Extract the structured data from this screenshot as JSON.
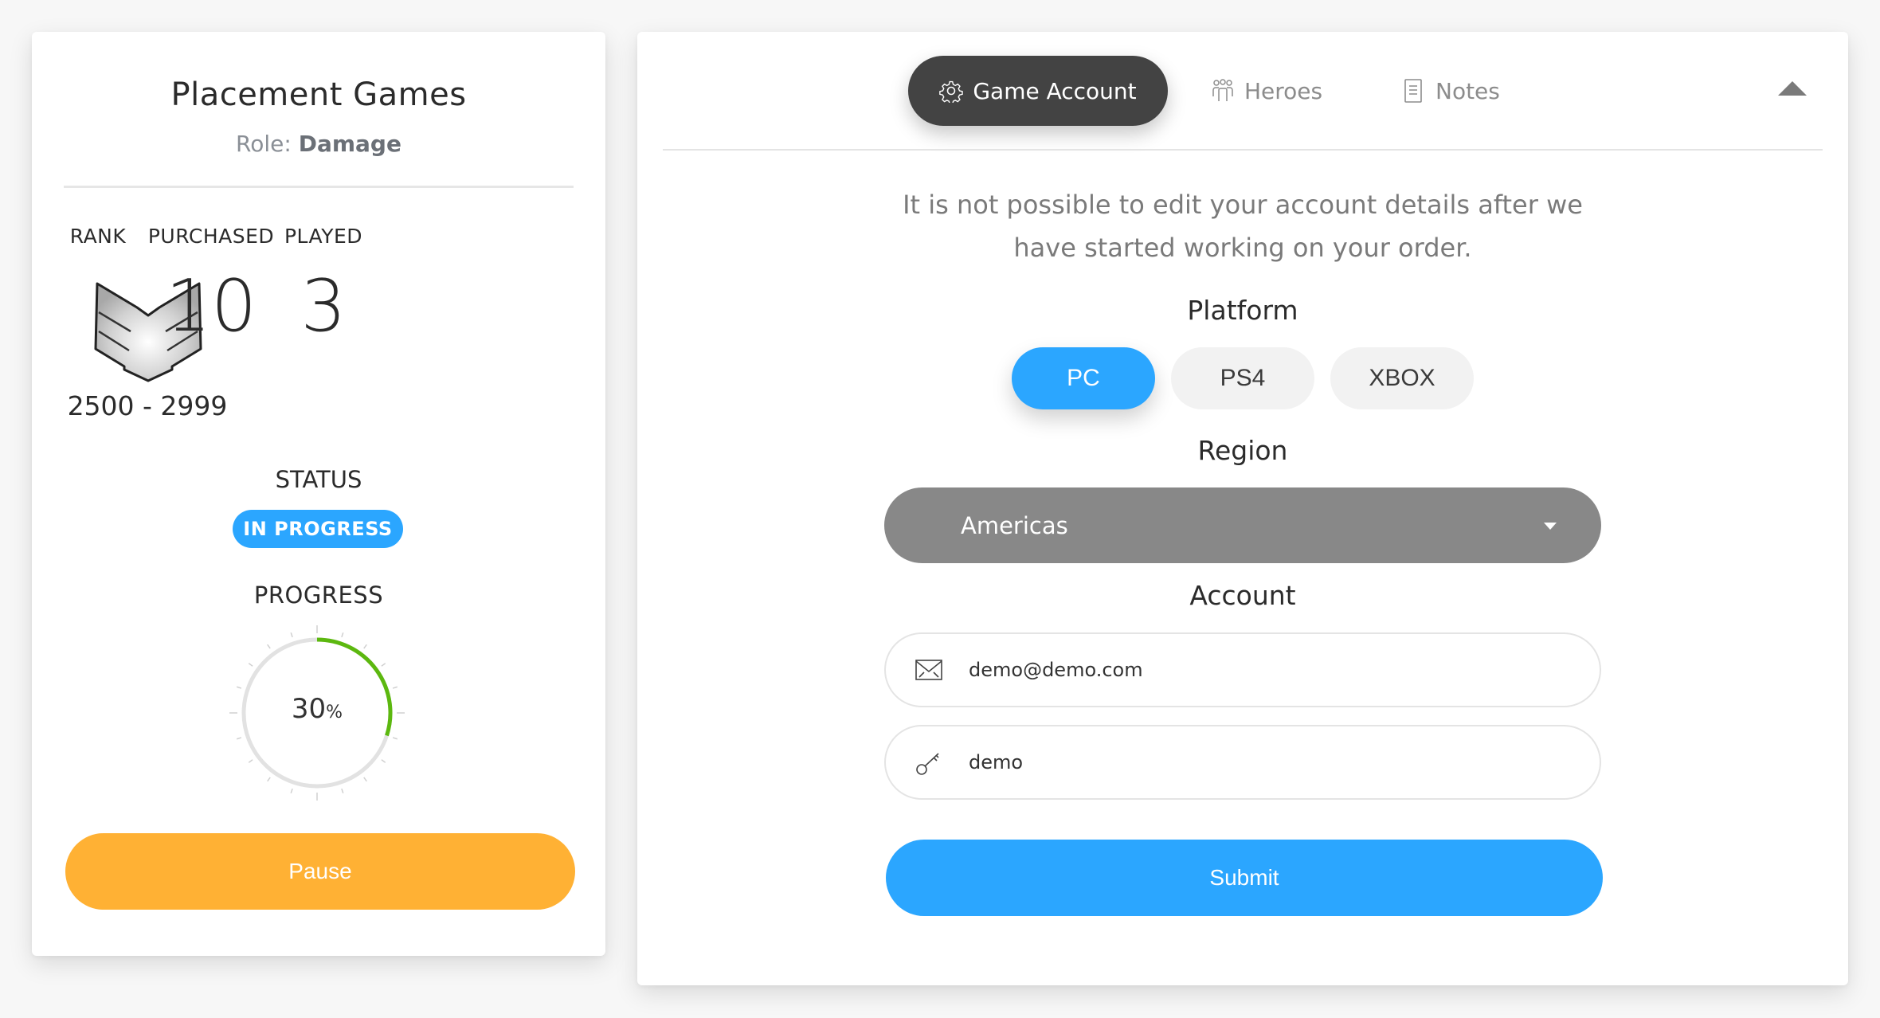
{
  "summary": {
    "title": "Placement Games",
    "role_label": "Role:",
    "role_value": "Damage",
    "stats": {
      "rank_label": "RANK",
      "purchased_label": "PURCHASED",
      "played_label": "PLAYED",
      "purchased_value": "10",
      "played_value": "3",
      "rank_icon": "chevron-rank-icon",
      "rank_range": "2500 - 2999"
    },
    "status_label": "STATUS",
    "status_value": "IN PROGRESS",
    "progress_label": "PROGRESS",
    "progress_value": 30,
    "progress_number": "30",
    "progress_unit": "%",
    "pause_label": "Pause"
  },
  "tabs": [
    {
      "label": "Game Account",
      "icon": "gear-icon",
      "active": true
    },
    {
      "label": "Heroes",
      "icon": "group-icon",
      "active": false
    },
    {
      "label": "Notes",
      "icon": "document-icon",
      "active": false
    }
  ],
  "collapse_icon": "triangle-up-icon",
  "account_form": {
    "notice": "It is not possible to edit your account details after we have started working on your order.",
    "platform_label": "Platform",
    "platforms": [
      {
        "label": "PC",
        "selected": true
      },
      {
        "label": "PS4",
        "selected": false
      },
      {
        "label": "XBOX",
        "selected": false
      }
    ],
    "region_label": "Region",
    "region_value": "Americas",
    "account_label": "Account",
    "email_value": "demo@demo.com",
    "password_value": "demo",
    "submit_label": "Submit"
  },
  "colors": {
    "accent_blue": "#2ba6ff",
    "pause_orange": "#ffb134",
    "progress_green": "#5cb80f",
    "active_tab_bg": "#434343",
    "select_bg": "#888888"
  }
}
